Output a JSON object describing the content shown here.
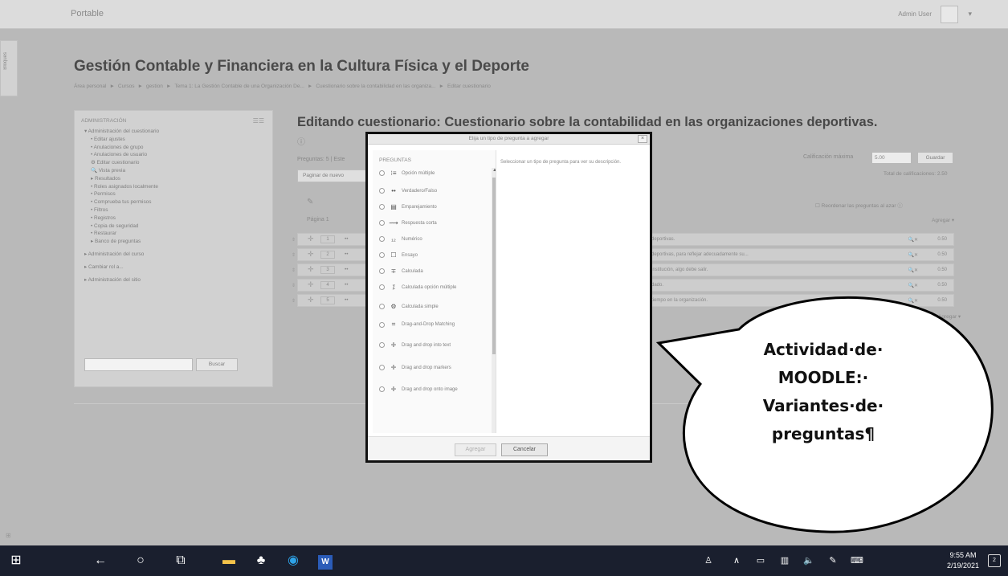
{
  "header": {
    "brand": "Portable",
    "user": "Admin User",
    "caret": "▾"
  },
  "side_tab": "Bloques",
  "course_title": "Gestión Contable y Financiera en la Cultura Física y el Deporte",
  "breadcrumb": [
    "Área personal",
    "Cursos",
    "gestion",
    "Tema 1: La Gestión Contable de una Organización De...",
    "Cuestionario sobre la contabilidad en las organiza...",
    "Editar cuestionario"
  ],
  "admin": {
    "heading": "ADMINISTRACIÓN",
    "nav": [
      {
        "label": "▾ Administración del cuestionario",
        "level": 1
      },
      {
        "label": "• Editar ajustes",
        "level": 2
      },
      {
        "label": "• Anulaciones de grupo",
        "level": 2
      },
      {
        "label": "• Anulaciones de usuario",
        "level": 2
      },
      {
        "label": "⚙ Editar cuestionario",
        "level": 2
      },
      {
        "label": "🔍 Vista previa",
        "level": 2
      },
      {
        "label": "▸ Resultados",
        "level": 2
      },
      {
        "label": "• Roles asignados localmente",
        "level": 2
      },
      {
        "label": "• Permisos",
        "level": 2
      },
      {
        "label": "• Comprueba tus permisos",
        "level": 2
      },
      {
        "label": "• Filtros",
        "level": 2
      },
      {
        "label": "• Registros",
        "level": 2
      },
      {
        "label": "• Copia de seguridad",
        "level": 2
      },
      {
        "label": "• Restaurar",
        "level": 2
      },
      {
        "label": "▸ Banco de preguntas",
        "level": 2
      },
      {
        "label": "",
        "level": 0
      },
      {
        "label": "▸ Administración del curso",
        "level": 1
      },
      {
        "label": "",
        "level": 0
      },
      {
        "label": "▸ Cambiar rol a...",
        "level": 1
      },
      {
        "label": "",
        "level": 0
      },
      {
        "label": "▸ Administración del sitio",
        "level": 1
      }
    ],
    "search_button": "Buscar"
  },
  "editor": {
    "title": "Editando cuestionario: Cuestionario sobre la contabilidad en las organizaciones deportivas.",
    "summary": "Preguntas: 5 | Este",
    "repaginate": "Paginar de nuevo",
    "page_label": "Página 1",
    "max_grade_label": "Calificación máxima",
    "max_grade_value": "5.00",
    "save_button": "Guardar",
    "total_marks": "Total de calificaciones: 2.50",
    "shuffle": "Reordenar las preguntas al azar",
    "add": "Agregar ▾",
    "questions": [
      {
        "num": "1",
        "text": "deportivas.",
        "mark": "0.50"
      },
      {
        "num": "2",
        "text": "deportivas, para reflejar adecuadamente su...",
        "mark": "0.50"
      },
      {
        "num": "3",
        "text": "institución, algo debe salir.",
        "mark": "0.50"
      },
      {
        "num": "4",
        "text": "dado.",
        "mark": "0.50"
      },
      {
        "num": "5",
        "text": "tiempo en la organización.",
        "mark": "0.50"
      }
    ]
  },
  "modal": {
    "title": "Elija un tipo de pregunta a agregar",
    "close": "×",
    "section": "PREGUNTAS",
    "options": [
      {
        "label": "Opción múltiple",
        "icon": "⁝≡"
      },
      {
        "label": "Verdadero/Falso",
        "icon": "••"
      },
      {
        "label": "Emparejamiento",
        "icon": "▤"
      },
      {
        "label": "Respuesta corta",
        "icon": "⟿"
      },
      {
        "label": "Numérico",
        "icon": "₁₂"
      },
      {
        "label": "Ensayo",
        "icon": "☐"
      },
      {
        "label": "Calculada",
        "icon": "∓"
      },
      {
        "label": "Calculada opción múltiple",
        "icon": "⁒"
      },
      {
        "label": "Calculada simple",
        "icon": "⚙"
      },
      {
        "label": "Drag-and-Drop Matching",
        "icon": "⌗"
      },
      {
        "label": "Drag and drop into text",
        "icon": "✛"
      },
      {
        "label": "Drag and drop markers",
        "icon": "✛"
      },
      {
        "label": "Drag and drop onto image",
        "icon": "✛"
      }
    ],
    "description": "Seleccionar un tipo de pregunta para ver su descripción.",
    "add_button": "Agregar",
    "cancel_button": "Cancelar"
  },
  "callout": [
    "Actividad·de·",
    "MOODLE:·",
    "Variantes·de·",
    "preguntas¶"
  ],
  "taskbar": {
    "time": "9:55 AM",
    "date": "2/19/2021",
    "notifications": "2"
  }
}
